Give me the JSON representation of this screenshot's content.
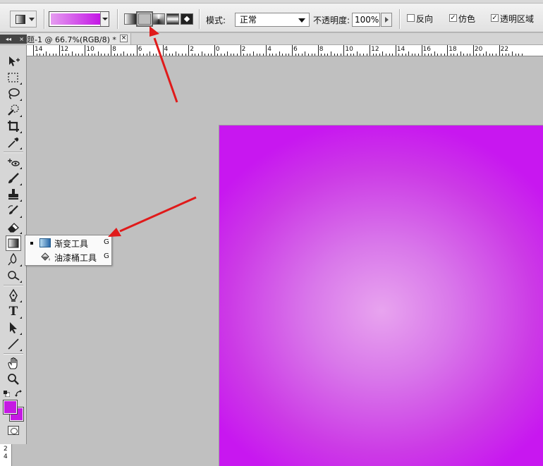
{
  "options_bar": {
    "mode_label": "模式:",
    "mode_value": "正常",
    "opacity_label": "不透明度:",
    "opacity_value": "100%",
    "reverse_label": "反向",
    "dither_label": "仿色",
    "transparency_label": "透明区域",
    "dither_check": "✓",
    "transparency_check": "✓",
    "gradient_colors": [
      "#e59cf0",
      "#c417e6"
    ]
  },
  "document": {
    "tab_title": "题-1 @ 66.7%(RGB/8) *",
    "close_glyph": "×"
  },
  "panel_toggle": {
    "collapse_glyph": "◂◂",
    "close_glyph": "×"
  },
  "ruler": {
    "h_labels": [
      "14",
      "12",
      "10",
      "8",
      "6",
      "4",
      "2",
      "0",
      "2",
      "4",
      "6",
      "8",
      "10",
      "12",
      "14",
      "16",
      "18",
      "20",
      "22"
    ],
    "v_labels": [
      "2",
      "4"
    ]
  },
  "flyout": {
    "items": [
      {
        "label": "渐变工具",
        "shortcut": "G"
      },
      {
        "label": "油漆桶工具",
        "shortcut": "G"
      }
    ]
  },
  "colors": {
    "foreground": "#c51ae3",
    "background": "#c51ae3",
    "canvas_center": "#e8a4ef",
    "canvas_edge": "#c817f0",
    "annotation_arrow": "#e01a1a"
  },
  "toolbox": {
    "tools": [
      "move-tool-icon",
      "marquee-tool-icon",
      "lasso-tool-icon",
      "quick-selection-tool-icon",
      "crop-tool-icon",
      "eyedropper-tool-icon",
      "healing-brush-tool-icon",
      "brush-tool-icon",
      "clone-stamp-tool-icon",
      "history-brush-tool-icon",
      "eraser-tool-icon",
      "gradient-tool-icon",
      "blur-tool-icon",
      "dodge-tool-icon",
      "pen-tool-icon",
      "type-tool-icon",
      "path-selection-tool-icon",
      "line-tool-icon",
      "hand-tool-icon",
      "zoom-tool-icon"
    ],
    "type_glyph": "T"
  }
}
